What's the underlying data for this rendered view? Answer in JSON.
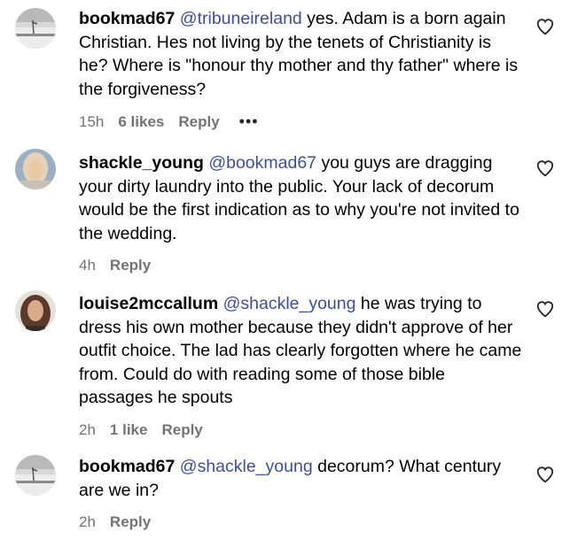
{
  "comments": [
    {
      "username": "bookmad67",
      "mention": "@tribuneireland",
      "text": " yes. Adam is a born again Christian. Hes not living by the tenets of Christianity is he? Where is \"honour thy mother and thy father\" where is the forgiveness?",
      "time": "15h",
      "likes": "6 likes",
      "reply": "Reply",
      "more": "•••",
      "avatar": "bookmad67-avatar"
    },
    {
      "username": "shackle_young",
      "mention": "@bookmad67",
      "text": " you guys are dragging your dirty laundry into the public. Your lack of decorum would be the first indication as to why you're not invited to the wedding.",
      "time": "4h",
      "likes": "",
      "reply": "Reply",
      "avatar": "shackle-young-avatar"
    },
    {
      "username": "louise2mccallum",
      "mention": "@shackle_young",
      "text": " he was trying to dress his own mother because they didn't approve of her outfit choice. The lad has clearly forgotten where he came from. Could do with reading some of those bible passages he spouts",
      "time": "2h",
      "likes": "1 like",
      "reply": "Reply",
      "avatar": "louise2mccallum-avatar"
    },
    {
      "username": "bookmad67",
      "mention": "@shackle_young",
      "text": " decorum? What century are we in?",
      "time": "2h",
      "likes": "",
      "reply": "Reply",
      "avatar": "bookmad67-avatar"
    }
  ],
  "colors": {
    "mention": "#3e4e9c",
    "meta": "#737373"
  }
}
